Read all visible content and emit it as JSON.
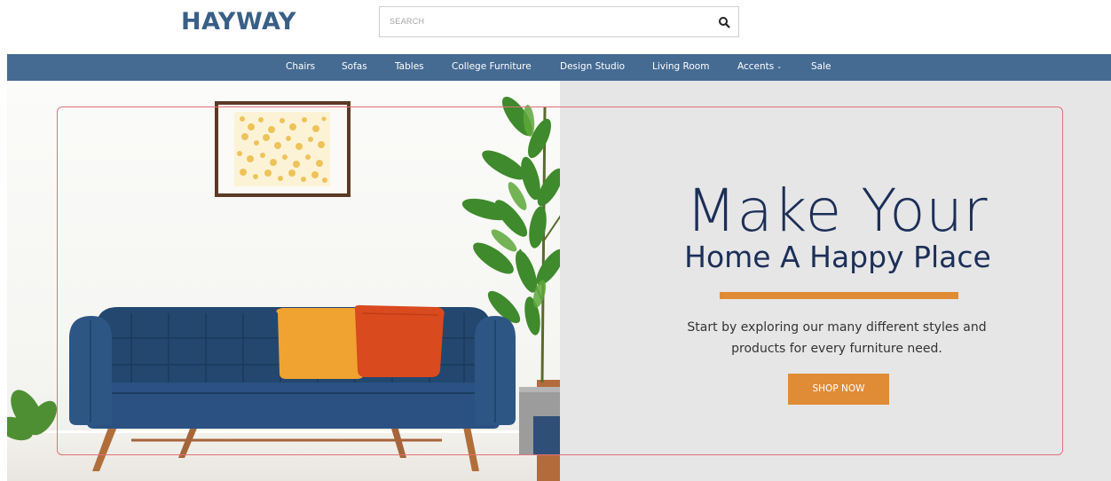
{
  "header": {
    "logo": "HAYWAY",
    "search": {
      "placeholder": "SEARCH",
      "value": "",
      "icon": "search-icon"
    }
  },
  "nav": {
    "items": [
      {
        "label": "Chairs"
      },
      {
        "label": "Sofas"
      },
      {
        "label": "Tables"
      },
      {
        "label": "College Furniture"
      },
      {
        "label": "Design Studio"
      },
      {
        "label": "Living Room"
      },
      {
        "label": "Accents",
        "dropdown": true
      },
      {
        "label": "Sale"
      }
    ],
    "caret": "⌄"
  },
  "hero": {
    "headline_line1": "Make Your",
    "headline_line2": "Home A Happy Place",
    "subtext": "Start by exploring our many different styles and products for every furniture need.",
    "cta_label": "SHOP NOW"
  },
  "colors": {
    "brand": "#3a5f86",
    "nav_bg": "#456b93",
    "headline": "#1c2f57",
    "accent": "#e08b36",
    "panel_bg": "#e6e6e7",
    "frame_border": "#e0717a"
  }
}
